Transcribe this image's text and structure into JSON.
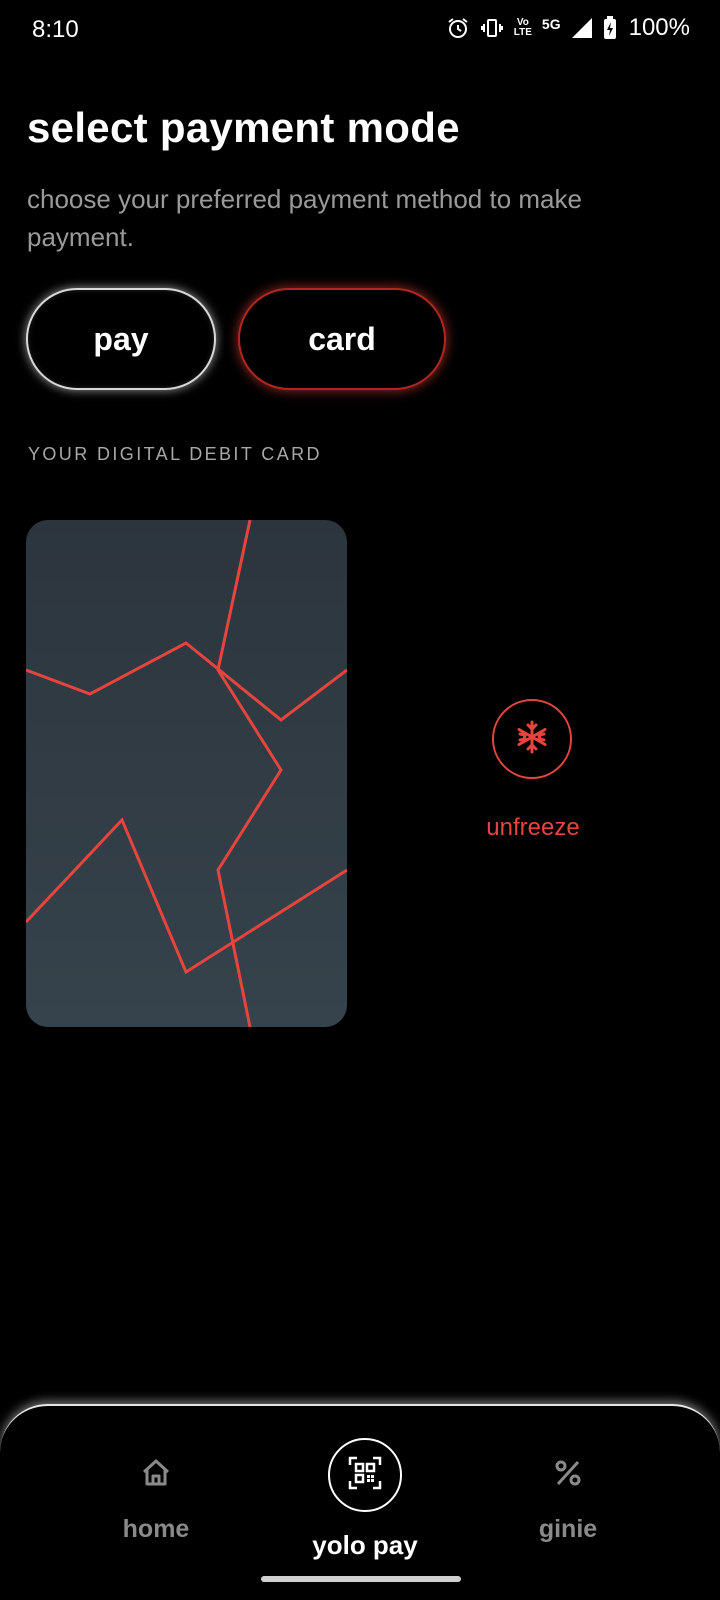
{
  "status_bar": {
    "time": "8:10",
    "volte_top": "Vo",
    "volte_bottom": "LTE",
    "network": "5G",
    "battery": "100%"
  },
  "header": {
    "title": "select payment mode",
    "subtitle": "choose your preferred payment method to make payment."
  },
  "mode_toggle": {
    "pay_label": "pay",
    "card_label": "card",
    "selected": "card"
  },
  "section_label": "YOUR DIGITAL DEBIT CARD",
  "freeze": {
    "icon": "snowflake-icon",
    "label": "unfreeze"
  },
  "bottom_nav": {
    "items": [
      {
        "label": "home",
        "icon": "home-icon"
      },
      {
        "label": "yolo pay",
        "icon": "qr-code-icon"
      },
      {
        "label": "ginie",
        "icon": "percent-icon"
      }
    ],
    "active": "yolo pay"
  },
  "colors": {
    "background": "#000000",
    "accent": "#e5453c",
    "card_top": "#2c353d",
    "card_bottom": "#36434c",
    "muted_text": "#9a9a9a"
  }
}
